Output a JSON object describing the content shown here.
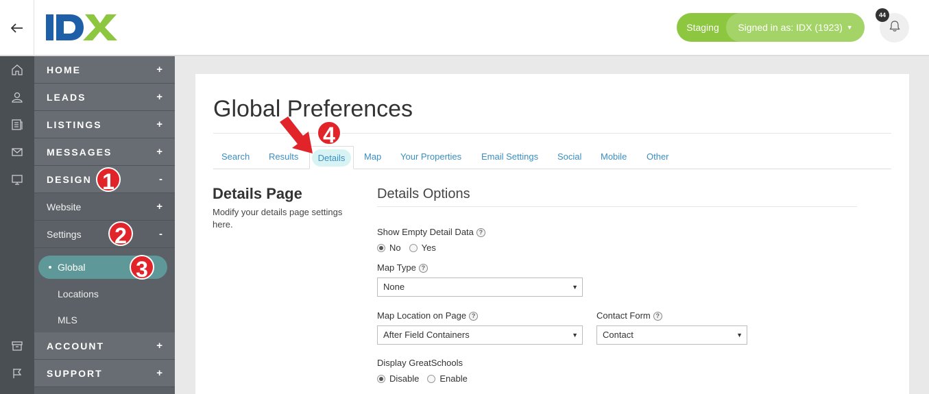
{
  "header": {
    "back_icon": "arrow-left-icon",
    "logo_text": "IDX",
    "staging_label": "Staging",
    "signed_in_label": "Signed in as: IDX (1923)",
    "notification_count": "44",
    "colors": {
      "brand_green": "#8dc63f",
      "logo_blue": "#1f5fa8"
    }
  },
  "rail": {
    "icons": [
      "home-icon",
      "user-icon",
      "listings-icon",
      "mail-icon",
      "monitor-icon",
      "archive-icon",
      "flag-icon"
    ]
  },
  "nav": {
    "home": {
      "label": "HOME",
      "toggle": "+"
    },
    "leads": {
      "label": "LEADS",
      "toggle": "+"
    },
    "listings": {
      "label": "LISTINGS",
      "toggle": "+"
    },
    "messages": {
      "label": "MESSAGES",
      "toggle": "+"
    },
    "design": {
      "label": "DESIGN",
      "toggle": "-"
    },
    "website": {
      "label": "Website",
      "toggle": "+"
    },
    "settings": {
      "label": "Settings",
      "toggle": "-"
    },
    "global": {
      "label": "Global"
    },
    "locations": {
      "label": "Locations"
    },
    "mls": {
      "label": "MLS"
    },
    "account": {
      "label": "ACCOUNT",
      "toggle": "+"
    },
    "support": {
      "label": "SUPPORT",
      "toggle": "+"
    }
  },
  "markers": [
    "1",
    "2",
    "3",
    "4"
  ],
  "main": {
    "page_title": "Global Preferences",
    "tabs": [
      {
        "label": "Search"
      },
      {
        "label": "Results"
      },
      {
        "label": "Details"
      },
      {
        "label": "Map"
      },
      {
        "label": "Your Properties"
      },
      {
        "label": "Email Settings"
      },
      {
        "label": "Social"
      },
      {
        "label": "Mobile"
      },
      {
        "label": "Other"
      }
    ],
    "section_title": "Details Page",
    "section_desc": "Modify your details page settings here.",
    "options_title": "Details Options",
    "show_empty": {
      "label": "Show Empty Detail Data",
      "options": [
        "No",
        "Yes"
      ],
      "selected": "No"
    },
    "map_type": {
      "label": "Map Type",
      "value": "None"
    },
    "map_location": {
      "label": "Map Location on Page",
      "value": "After Field Containers"
    },
    "contact_form": {
      "label": "Contact Form",
      "value": "Contact"
    },
    "greatschools": {
      "label": "Display GreatSchools",
      "options": [
        "Disable",
        "Enable"
      ],
      "selected": "Disable"
    },
    "help_glyph": "?"
  }
}
